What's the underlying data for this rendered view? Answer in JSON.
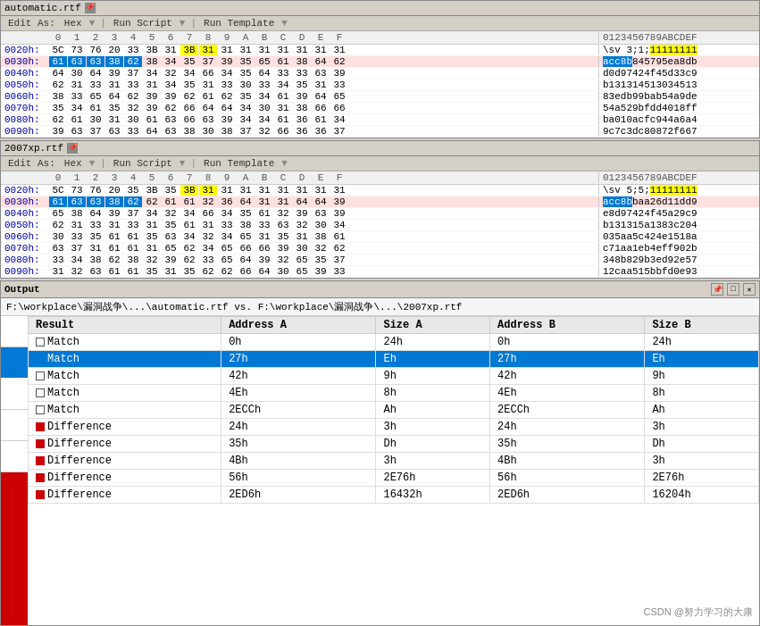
{
  "panels": [
    {
      "id": "panel1",
      "title": "automatic.rtf",
      "menuItems": [
        "Edit As:",
        "Hex",
        "|",
        "Run Script",
        "▼",
        "|",
        "Run Template",
        "▼"
      ],
      "hexHeader": [
        "0",
        "1",
        "2",
        "3",
        "4",
        "5",
        "6",
        "7",
        "8",
        "9",
        "A",
        "B",
        "C",
        "D",
        "E",
        "F"
      ],
      "asciiHeader": "0123456789ABCDEF",
      "rows": [
        {
          "addr": "0020h:",
          "bytes": [
            "5C",
            "73",
            "76",
            "20",
            "33",
            "3B",
            "31",
            "3B",
            "31",
            "31",
            "31",
            "31",
            "31",
            "31",
            "31",
            "31"
          ],
          "ascii": "\\sv 3;1;11111111",
          "byteHighlights": [
            7,
            8
          ],
          "asciiHighlight": "yellow"
        },
        {
          "addr": "0030h:",
          "bytes": [
            "61",
            "63",
            "63",
            "38",
            "62",
            "38",
            "34",
            "35",
            "37",
            "39",
            "35",
            "65",
            "61",
            "38",
            "64",
            "62"
          ],
          "ascii": "acc8b845795ea8db",
          "byteHighlights": [
            0,
            1,
            2,
            3,
            4
          ],
          "asciiHighlightRange": [
            0,
            5
          ],
          "rowHighlight": "pink"
        },
        {
          "addr": "0040h:",
          "bytes": [
            "64",
            "30",
            "64",
            "39",
            "37",
            "34",
            "32",
            "34",
            "66",
            "34",
            "35",
            "64",
            "33",
            "33",
            "63",
            "39"
          ],
          "ascii": "d0d97424f45d33c9",
          "byteHighlights": [],
          "asciiHighlight": null
        },
        {
          "addr": "0050h:",
          "bytes": [
            "62",
            "31",
            "33",
            "31",
            "33",
            "31",
            "34",
            "35",
            "31",
            "33",
            "30",
            "33",
            "34",
            "35",
            "31",
            "33"
          ],
          "ascii": "b131314513034513",
          "byteHighlights": [],
          "asciiHighlight": null
        },
        {
          "addr": "0060h:",
          "bytes": [
            "38",
            "33",
            "65",
            "64",
            "62",
            "39",
            "39",
            "62",
            "61",
            "62",
            "35",
            "34",
            "61",
            "39",
            "64",
            "65"
          ],
          "ascii": "83edb99bab54a9de",
          "byteHighlights": [],
          "asciiHighlight": null
        },
        {
          "addr": "0070h:",
          "bytes": [
            "35",
            "34",
            "61",
            "35",
            "32",
            "39",
            "62",
            "66",
            "64",
            "64",
            "34",
            "30",
            "31",
            "38",
            "66",
            "66"
          ],
          "ascii": "54a529bfdd4018ff",
          "byteHighlights": [],
          "asciiHighlight": null
        },
        {
          "addr": "0080h:",
          "bytes": [
            "62",
            "61",
            "30",
            "31",
            "30",
            "61",
            "63",
            "66",
            "63",
            "39",
            "34",
            "34",
            "61",
            "36",
            "61",
            "34"
          ],
          "ascii": "ba010acfc944a6a4",
          "byteHighlights": [],
          "asciiHighlight": null
        },
        {
          "addr": "0090h:",
          "bytes": [
            "39",
            "63",
            "37",
            "63",
            "33",
            "64",
            "63",
            "38",
            "30",
            "38",
            "37",
            "32",
            "66",
            "36",
            "36",
            "37"
          ],
          "ascii": "9c7c3dc80872f667",
          "byteHighlights": [],
          "asciiHighlight": null
        }
      ]
    },
    {
      "id": "panel2",
      "title": "2007xp.rtf",
      "menuItems": [
        "Edit As:",
        "Hex",
        "|",
        "Run Script",
        "▼",
        "|",
        "Run Template",
        "▼"
      ],
      "hexHeader": [
        "0",
        "1",
        "2",
        "3",
        "4",
        "5",
        "6",
        "7",
        "8",
        "9",
        "A",
        "B",
        "C",
        "D",
        "E",
        "F"
      ],
      "asciiHeader": "0123456789ABCDEF",
      "rows": [
        {
          "addr": "0020h:",
          "bytes": [
            "5C",
            "73",
            "76",
            "20",
            "35",
            "3B",
            "35",
            "3B",
            "31",
            "31",
            "31",
            "31",
            "31",
            "31",
            "31",
            "31"
          ],
          "ascii": "\\sv 5;5;11111111",
          "byteHighlights": [
            7,
            8
          ],
          "asciiHighlight": "yellow"
        },
        {
          "addr": "0030h:",
          "bytes": [
            "61",
            "63",
            "63",
            "38",
            "62",
            "62",
            "61",
            "61",
            "32",
            "36",
            "64",
            "31",
            "31",
            "64",
            "64",
            "39"
          ],
          "ascii": "acc8bbaa26d11dd9",
          "byteHighlights": [
            0,
            1,
            2,
            3,
            4
          ],
          "asciiHighlightRange": [
            0,
            5
          ],
          "rowHighlight": "pink"
        },
        {
          "addr": "0040h:",
          "bytes": [
            "65",
            "38",
            "64",
            "39",
            "37",
            "34",
            "32",
            "34",
            "66",
            "34",
            "35",
            "61",
            "32",
            "39",
            "63",
            "39"
          ],
          "ascii": "e8d97424f45a29c9",
          "byteHighlights": [],
          "asciiHighlight": null
        },
        {
          "addr": "0050h:",
          "bytes": [
            "62",
            "31",
            "33",
            "31",
            "33",
            "31",
            "35",
            "61",
            "31",
            "33",
            "38",
            "33",
            "63",
            "32",
            "30",
            "34"
          ],
          "ascii": "b131315a1383c204",
          "byteHighlights": [],
          "asciiHighlight": null
        },
        {
          "addr": "0060h:",
          "bytes": [
            "30",
            "33",
            "35",
            "61",
            "61",
            "35",
            "63",
            "34",
            "32",
            "34",
            "65",
            "31",
            "35",
            "31",
            "38",
            "61"
          ],
          "ascii": "035aa5c424e1518a",
          "byteHighlights": [],
          "asciiHighlight": null
        },
        {
          "addr": "0070h:",
          "bytes": [
            "63",
            "37",
            "31",
            "61",
            "61",
            "31",
            "65",
            "62",
            "34",
            "65",
            "66",
            "66",
            "39",
            "30",
            "32",
            "62"
          ],
          "ascii": "c71aa1eb4eff902b",
          "byteHighlights": [],
          "asciiHighlight": null
        },
        {
          "addr": "0080h:",
          "bytes": [
            "33",
            "34",
            "38",
            "62",
            "38",
            "32",
            "39",
            "62",
            "33",
            "65",
            "64",
            "39",
            "32",
            "65",
            "35",
            "37"
          ],
          "ascii": "348b829b3ed92e57",
          "byteHighlights": [],
          "asciiHighlight": null
        },
        {
          "addr": "0090h:",
          "bytes": [
            "31",
            "32",
            "63",
            "61",
            "61",
            "35",
            "31",
            "35",
            "62",
            "62",
            "66",
            "64",
            "30",
            "65",
            "39",
            "33"
          ],
          "ascii": "12caa515bbfd0e93",
          "byteHighlights": [],
          "asciiHighlight": null
        }
      ]
    }
  ],
  "output": {
    "title": "Output",
    "filepath": "F:\\workplace\\漏洞战争\\...\\automatic.rtf   vs.   F:\\workplace\\漏洞战争\\...\\2007xp.rtf",
    "columns": [
      "Result",
      "Address A",
      "Size A",
      "Address B",
      "Size B"
    ],
    "rows": [
      {
        "result": "Match",
        "icon": "empty",
        "addrA": "0h",
        "sizeA": "24h",
        "addrB": "0h",
        "sizeB": "24h",
        "selected": false
      },
      {
        "result": "Match",
        "icon": "filled",
        "addrA": "27h",
        "sizeA": "Eh",
        "addrB": "27h",
        "sizeB": "Eh",
        "selected": true
      },
      {
        "result": "Match",
        "icon": "empty",
        "addrA": "42h",
        "sizeA": "9h",
        "addrB": "42h",
        "sizeB": "9h",
        "selected": false
      },
      {
        "result": "Match",
        "icon": "empty",
        "addrA": "4Eh",
        "sizeA": "8h",
        "addrB": "4Eh",
        "sizeB": "8h",
        "selected": false
      },
      {
        "result": "Match",
        "icon": "empty",
        "addrA": "2ECCh",
        "sizeA": "Ah",
        "addrB": "2ECCh",
        "sizeB": "Ah",
        "selected": false
      },
      {
        "result": "Difference",
        "icon": "diff",
        "addrA": "24h",
        "sizeA": "3h",
        "addrB": "24h",
        "sizeB": "3h",
        "selected": false
      },
      {
        "result": "Difference",
        "icon": "diff",
        "addrA": "35h",
        "sizeA": "Dh",
        "addrB": "35h",
        "sizeB": "Dh",
        "selected": false
      },
      {
        "result": "Difference",
        "icon": "diff",
        "addrA": "4Bh",
        "sizeA": "3h",
        "addrB": "4Bh",
        "sizeB": "3h",
        "selected": false
      },
      {
        "result": "Difference",
        "icon": "diff",
        "addrA": "56h",
        "sizeA": "2E76h",
        "addrB": "56h",
        "sizeB": "2E76h",
        "selected": false
      },
      {
        "result": "Difference",
        "icon": "diff",
        "addrA": "2ED6h",
        "sizeA": "16432h",
        "addrB": "2ED6h",
        "sizeB": "16204h",
        "selected": false
      }
    ]
  },
  "watermark": "CSDN @努力学习的大康"
}
